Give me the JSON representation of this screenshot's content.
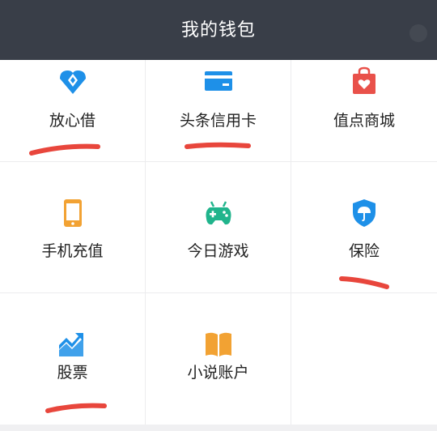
{
  "header": {
    "title": "我的钱包"
  },
  "colors": {
    "header_bg": "#393e48",
    "icon_blue": "#1e90e8",
    "icon_red": "#e9514a",
    "icon_orange": "#f2a233",
    "icon_green": "#20b48c",
    "underline_red": "#e8463c"
  },
  "items": [
    {
      "id": "fangxinjie",
      "label": "放心借",
      "icon": "diamond-loan-icon"
    },
    {
      "id": "toutiao-card",
      "label": "头条信用卡",
      "icon": "credit-card-icon"
    },
    {
      "id": "zhidian-mall",
      "label": "值点商城",
      "icon": "shopping-bag-icon"
    },
    {
      "id": "phone-recharge",
      "label": "手机充值",
      "icon": "mobile-phone-icon"
    },
    {
      "id": "games",
      "label": "今日游戏",
      "icon": "gamepad-icon"
    },
    {
      "id": "insurance",
      "label": "保险",
      "icon": "shield-umbrella-icon"
    },
    {
      "id": "stocks",
      "label": "股票",
      "icon": "stock-chart-icon"
    },
    {
      "id": "novel-account",
      "label": "小说账户",
      "icon": "open-book-icon"
    }
  ]
}
